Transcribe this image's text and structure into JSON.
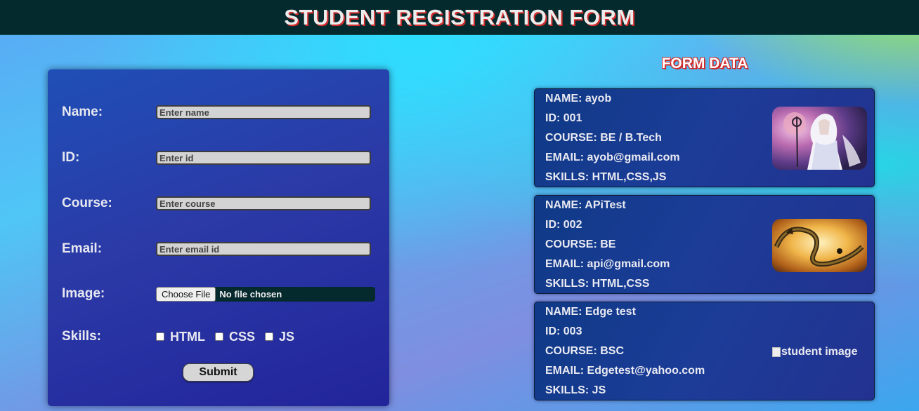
{
  "header": {
    "title": "STUDENT REGISTRATION FORM"
  },
  "form": {
    "fields": {
      "name": {
        "label": "Name:",
        "placeholder": "Enter name"
      },
      "id": {
        "label": "ID:",
        "placeholder": "Enter id"
      },
      "course": {
        "label": "Course:",
        "placeholder": "Enter course"
      },
      "email": {
        "label": "Email:",
        "placeholder": "Enter email id"
      }
    },
    "image": {
      "label": "Image:",
      "button": "Choose File",
      "status": "No file chosen"
    },
    "skills": {
      "label": "Skills:",
      "options": [
        "HTML",
        "CSS",
        "JS"
      ]
    },
    "submit_label": "Submit"
  },
  "form_data": {
    "title": "FORM DATA",
    "cards": [
      {
        "name": "NAME: ayob",
        "id": "ID: 001",
        "course": "COURSE: BE / B.Tech",
        "email": "EMAIL: ayob@gmail.com",
        "skills": "SKILLS: HTML,CSS,JS",
        "image": "white-haired-warrior-image"
      },
      {
        "name": "NAME: APiTest",
        "id": "ID: 002",
        "course": "COURSE: BE",
        "email": "EMAIL: api@gmail.com",
        "skills": "SKILLS: HTML,CSS",
        "image": "golden-dragon-image"
      },
      {
        "name": "NAME: Edge test",
        "id": "ID: 003",
        "course": "COURSE: BSC",
        "email": "EMAIL: Edgetest@yahoo.com",
        "skills": "SKILLS: JS",
        "image_alt": "student image"
      }
    ]
  },
  "colors": {
    "header_bg": "#052a2d",
    "title_shadow": "#d12b2b",
    "card_bg": "#1c3c98"
  }
}
